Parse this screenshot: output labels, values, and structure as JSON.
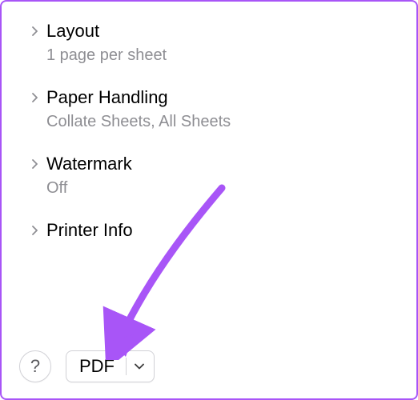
{
  "sections": [
    {
      "title": "Layout",
      "subtitle": "1 page per sheet"
    },
    {
      "title": "Paper Handling",
      "subtitle": "Collate Sheets, All Sheets"
    },
    {
      "title": "Watermark",
      "subtitle": "Off"
    },
    {
      "title": "Printer Info",
      "subtitle": ""
    }
  ],
  "help_button": "?",
  "pdf_button": {
    "label": "PDF"
  },
  "colors": {
    "accent": "#A855F7",
    "text_secondary": "#8E8E93",
    "border": "#D1D1D6"
  }
}
